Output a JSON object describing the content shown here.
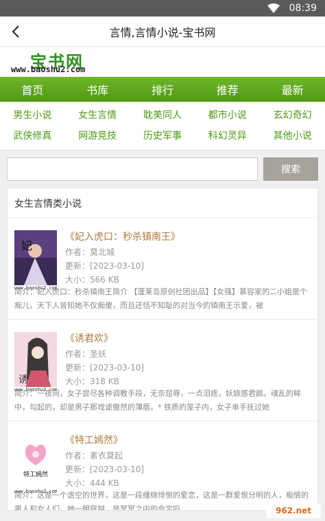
{
  "status": {
    "time": "08:39"
  },
  "appbar": {
    "title": "言情,言情小说-宝书网"
  },
  "site": {
    "logo_text": "宝书网",
    "logo_url": "www.baoshu2.com"
  },
  "nav": {
    "items": [
      "首页",
      "书库",
      "排行",
      "推荐",
      "最新"
    ]
  },
  "categories": {
    "row1": [
      "男生小说",
      "女生言情",
      "耽美同人",
      "都市小说",
      "玄幻奇幻"
    ],
    "row2": [
      "武侠修真",
      "网游竞技",
      "历史军事",
      "科幻灵异",
      "其他小说"
    ]
  },
  "search": {
    "value": "",
    "button": "搜索"
  },
  "section": {
    "title": "女生言情类小说"
  },
  "books": [
    {
      "title": "《妃入虎口：秒杀镇南王》",
      "author": "作者：莫北城",
      "updated": "更新：[2023-03-10]",
      "size": "大小：566 KB",
      "desc": "简介：妃入虎口：秒杀镇南王简介 【蓬莱岛原创社团出品】【女强】慕容家的二小姐是个痴儿，天下人皆知她不仅痴傻，而且还恬不知耻的对当今的镇南王示爱，被",
      "cover_caption": "www.baoshu2.com"
    },
    {
      "title": "《诱君欢》",
      "author": "作者：圣妖",
      "updated": "更新：[2023-03-10]",
      "size": "大小：318 KB",
      "desc": "简介：一夜间，女子尝尽各种调教手段，无奈屈辱，一点泪痣，妖娆惑君颜。魂乱的眸中，勾起的，却是男子那戏谑傲然的薄唇。* 铁质的笼子内，女子单手抚过她",
      "cover_caption": "www.baoshu2.com"
    },
    {
      "title": "《特工嫣然》",
      "author": "作者：素衣莫起",
      "updated": "更新：[2023-03-10]",
      "size": "大小：444 KB",
      "desc": "简介：这是一个虐空的世界，这是一段缠绵悱恻的爱恋，这是一群爱恨分明的人，痴情的男人和女人们，她一朝穿越，是冥冥之中的命定吗",
      "cover_caption": "www.baoshu2.com",
      "cover_text": "特工嫣然"
    }
  ],
  "watermark": {
    "text": "962.net"
  }
}
